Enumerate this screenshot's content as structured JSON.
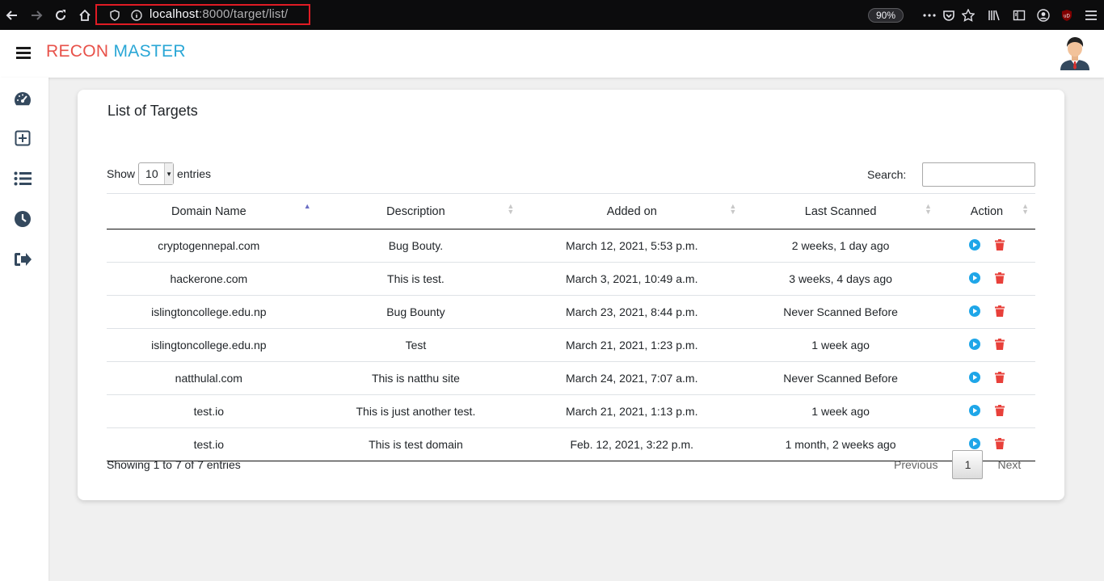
{
  "browser": {
    "url_host": "localhost",
    "url_rest": ":8000/target/list/",
    "zoom": "90%"
  },
  "app": {
    "brand_part1": "RECON",
    "brand_part2": "MASTER"
  },
  "sidebar": {
    "items": [
      {
        "icon": "dashboard-icon"
      },
      {
        "icon": "add-target-icon"
      },
      {
        "icon": "list-icon"
      },
      {
        "icon": "history-icon"
      },
      {
        "icon": "logout-icon"
      }
    ]
  },
  "card": {
    "title": "List of Targets"
  },
  "table_controls": {
    "show_label": "Show",
    "entries_value": "10",
    "entries_label": "entries",
    "search_label": "Search:",
    "search_value": ""
  },
  "table": {
    "columns": [
      "Domain Name",
      "Description",
      "Added on",
      "Last Scanned",
      "Action"
    ],
    "rows": [
      {
        "domain": "cryptogennepal.com",
        "description": "Bug Bouty.",
        "added_on": "March 12, 2021, 5:53 p.m.",
        "last_scanned": "2 weeks, 1 day ago"
      },
      {
        "domain": "hackerone.com",
        "description": "This is test.",
        "added_on": "March 3, 2021, 10:49 a.m.",
        "last_scanned": "3 weeks, 4 days ago"
      },
      {
        "domain": "islingtoncollege.edu.np",
        "description": "Bug Bounty",
        "added_on": "March 23, 2021, 8:44 p.m.",
        "last_scanned": "Never Scanned Before"
      },
      {
        "domain": "islingtoncollege.edu.np",
        "description": "Test",
        "added_on": "March 21, 2021, 1:23 p.m.",
        "last_scanned": "1 week ago"
      },
      {
        "domain": "natthulal.com",
        "description": "This is natthu site",
        "added_on": "March 24, 2021, 7:07 a.m.",
        "last_scanned": "Never Scanned Before"
      },
      {
        "domain": "test.io",
        "description": "This is just another test.",
        "added_on": "March 21, 2021, 1:13 p.m.",
        "last_scanned": "1 week ago"
      },
      {
        "domain": "test.io",
        "description": "This is test domain",
        "added_on": "Feb. 12, 2021, 3:22 p.m.",
        "last_scanned": "1 month, 2 weeks ago"
      }
    ]
  },
  "footer": {
    "info": "Showing 1 to 7 of 7 entries",
    "previous": "Previous",
    "page": "1",
    "next": "Next"
  },
  "colors": {
    "brand_red": "#e8524a",
    "brand_blue": "#2aa7d6",
    "scan_icon": "#1fa6e8",
    "delete_icon": "#e8403a"
  }
}
